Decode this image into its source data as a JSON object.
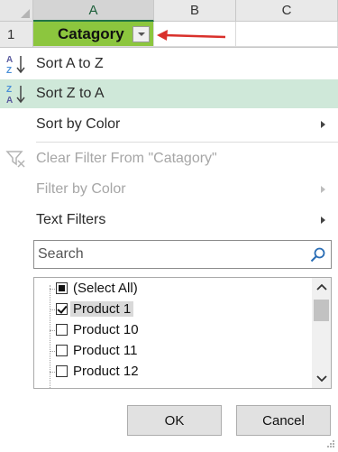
{
  "grid": {
    "columns": [
      "A",
      "B",
      "C"
    ],
    "row_number": "1",
    "cell_a1": "Catagory"
  },
  "menu": {
    "sort_az": "Sort A to Z",
    "sort_za": "Sort Z to A",
    "sort_by_color": "Sort by Color",
    "clear_filter": "Clear Filter From \"Catagory\"",
    "filter_by_color": "Filter by Color",
    "text_filters": "Text Filters"
  },
  "search": {
    "placeholder": "Search"
  },
  "list": {
    "items": [
      {
        "label": "(Select All)",
        "state": "partial"
      },
      {
        "label": "Product 1",
        "state": "checked"
      },
      {
        "label": "Product 10",
        "state": "unchecked"
      },
      {
        "label": "Product 11",
        "state": "unchecked"
      },
      {
        "label": "Product 12",
        "state": "unchecked"
      }
    ]
  },
  "buttons": {
    "ok": "OK",
    "cancel": "Cancel"
  },
  "colors": {
    "header_fill": "#8cc63e",
    "highlight": "#cfe8d9",
    "arrow": "#d9302b"
  }
}
